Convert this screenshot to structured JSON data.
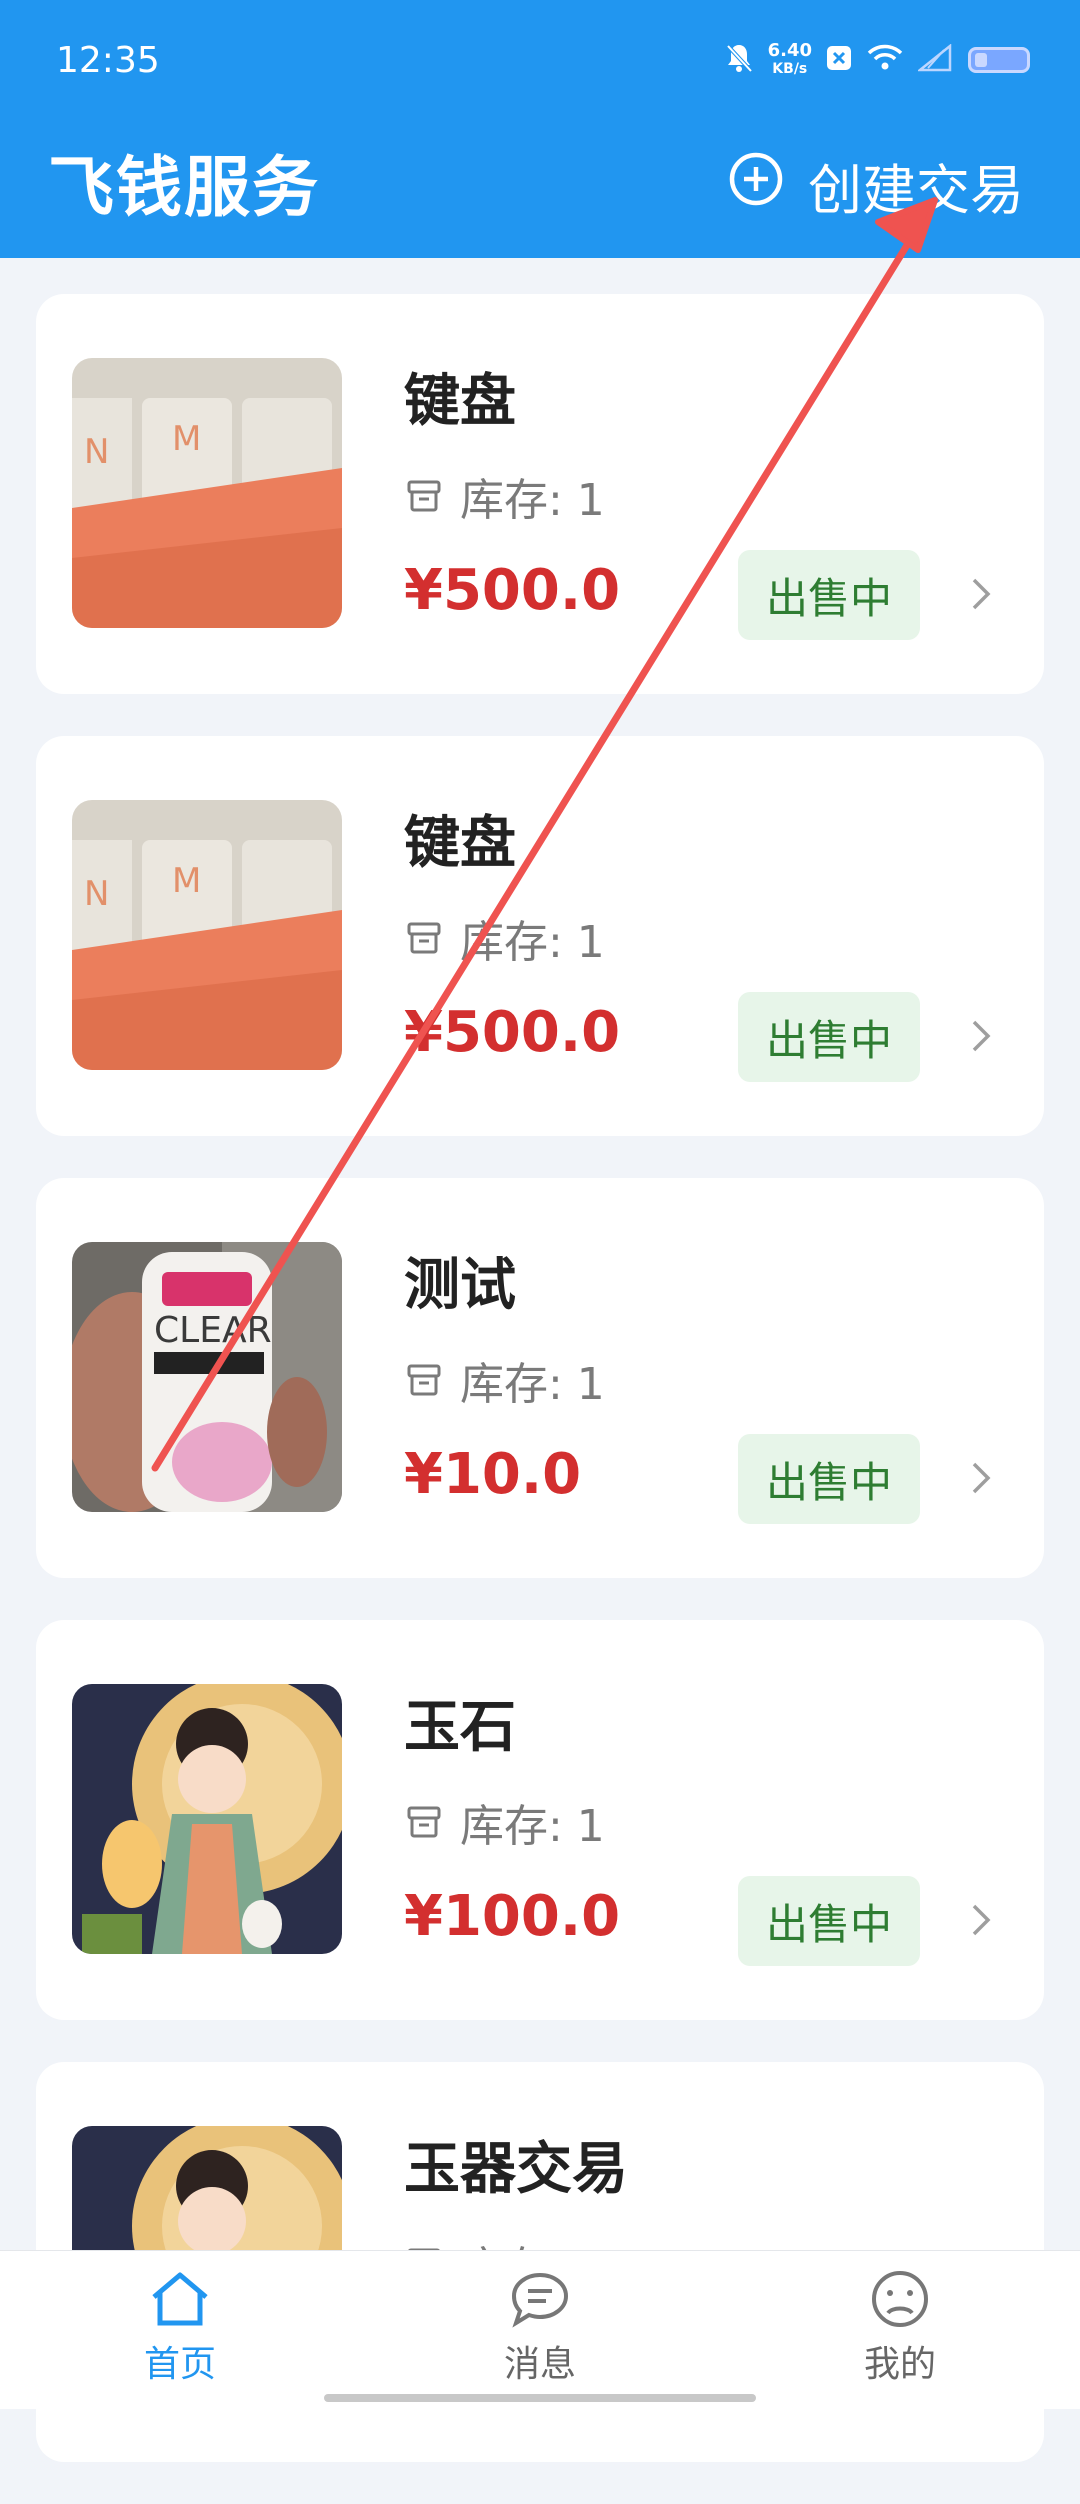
{
  "status_bar": {
    "time": "12:35",
    "speed_value": "6.40",
    "speed_unit": "KB/s"
  },
  "header": {
    "title": "飞钱服务",
    "create_label": "创建交易"
  },
  "stock_label": "库存: 1",
  "items": [
    {
      "title": "键盘",
      "price": "¥500.0",
      "status": "出售中"
    },
    {
      "title": "键盘",
      "price": "¥500.0",
      "status": "出售中"
    },
    {
      "title": "测试",
      "price": "¥10.0",
      "status": "出售中"
    },
    {
      "title": "玉石",
      "price": "¥100.0",
      "status": "出售中"
    },
    {
      "title": "玉器交易"
    }
  ],
  "tabs": [
    {
      "label": "首页",
      "active": true
    },
    {
      "label": "消息"
    },
    {
      "label": "我的"
    }
  ],
  "colors": {
    "primary": "#2196f0",
    "price": "#d32f2f",
    "badge_bg": "#e7f5e9",
    "badge_text": "#2e7d32",
    "annotation": "#ef5350"
  }
}
